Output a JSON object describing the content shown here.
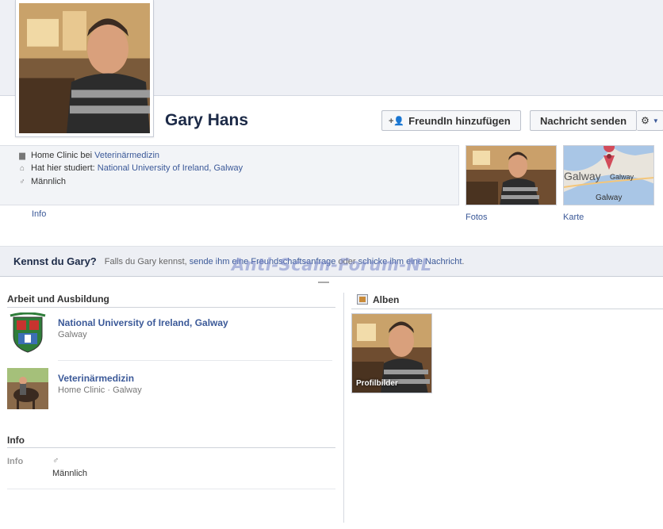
{
  "profile": {
    "name": "Gary Hans"
  },
  "actions": {
    "add_friend": "FreundIn hinzufügen",
    "send_message": "Nachricht senden"
  },
  "about": {
    "work_prefix": "Home Clinic bei",
    "work_link": "Veterinärmedizin",
    "study_prefix": "Hat hier studiert:",
    "study_link": "National University of Ireland, Galway",
    "gender": "Männlich",
    "info_link": "Info"
  },
  "thumbs": {
    "fotos": "Fotos",
    "karte": "Karte",
    "map_city": "Galway",
    "map_pin_label": "Galway",
    "map_bottom": "Galway"
  },
  "know_bar": {
    "title": "Kennst du Gary?",
    "text_before": "Falls du Gary kennst,",
    "link_request": "sende ihm eine Freundschaftsanfrage",
    "text_middle": "oder",
    "link_message": "schicke ihm eine Nachricht",
    "text_after": "."
  },
  "watermark": "Anti-Scam-Forum-NL",
  "work_edu": {
    "heading": "Arbeit und Ausbildung",
    "items": [
      {
        "title": "National University of Ireland, Galway",
        "sub": "Galway"
      },
      {
        "title": "Veterinärmedizin",
        "sub": "Home Clinic · Galway"
      }
    ]
  },
  "info_section": {
    "heading": "Info",
    "label": "Info",
    "gender": "Männlich"
  },
  "albums": {
    "heading": "Alben",
    "album_label": "Profilbilder"
  },
  "colors": {
    "link": "#3b5998",
    "name": "#1c2a47",
    "bar_bg": "#edeff4"
  }
}
